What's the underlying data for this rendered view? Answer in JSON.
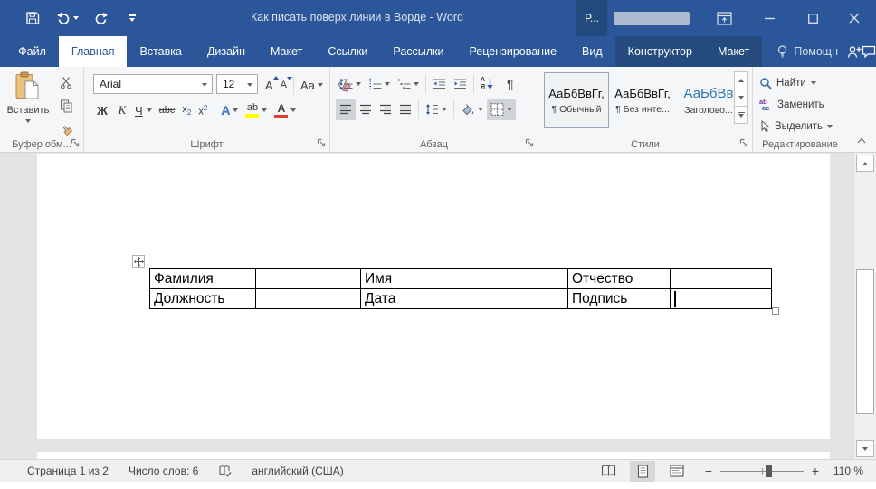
{
  "window": {
    "title": "Как писать поверх линии в Ворде - Word",
    "user": "Р..."
  },
  "tabs": [
    {
      "label": "Файл"
    },
    {
      "label": "Главная"
    },
    {
      "label": "Вставка"
    },
    {
      "label": "Дизайн"
    },
    {
      "label": "Макет"
    },
    {
      "label": "Ссылки"
    },
    {
      "label": "Рассылки"
    },
    {
      "label": "Рецензирование"
    },
    {
      "label": "Вид"
    },
    {
      "label": "Конструктор"
    },
    {
      "label": "Макет"
    }
  ],
  "help_label": "Помощн",
  "ribbon": {
    "clipboard": {
      "paste_label": "Вставить",
      "group_label": "Буфер обм..."
    },
    "font": {
      "font_name": "Arial",
      "font_size": "12",
      "bold": "Ж",
      "italic": "К",
      "underline": "Ч",
      "strikethrough": "abc",
      "sub_base": "x",
      "sub_mark": "2",
      "sup_base": "x",
      "sup_mark": "2",
      "grow": "А",
      "shrink": "А",
      "case_label": "Aa",
      "effects_label": "А",
      "highlight_label": "ab",
      "color_label": "А",
      "group_label": "Шрифт"
    },
    "paragraph": {
      "sort_a": "А",
      "sort_z": "Я",
      "pilcrow": "¶",
      "group_label": "Абзац"
    },
    "styles": {
      "group_label": "Стили",
      "items": [
        {
          "preview": "АаБбВвГг,",
          "name": "¶ Обычный"
        },
        {
          "preview": "АаБбВвГг,",
          "name": "¶ Без инте..."
        },
        {
          "preview": "АаБбВв",
          "name": "Заголово..."
        }
      ]
    },
    "editing": {
      "find": "Найти",
      "replace": "Заменить",
      "select": "Выделить",
      "group_label": "Редактирование"
    }
  },
  "icon_text": {
    "replace_top": "ab",
    "replace_bottom": "ac"
  },
  "document": {
    "table": {
      "rows": [
        [
          "Фамилия",
          "",
          "Имя",
          "",
          "Отчество",
          ""
        ],
        [
          "Должность",
          "",
          "Дата",
          "",
          "Подпись",
          ""
        ]
      ]
    }
  },
  "status_bar": {
    "page": "Страница 1 из 2",
    "words": "Число слов: 6",
    "language": "английский (США)",
    "zoom": "110 %"
  },
  "colors": {
    "titlebar": "#2b579a",
    "contextual_tab_bg": "#254a7d",
    "active_tab_text": "#2b579a",
    "highlight_yellow": "#ffff00",
    "font_color_red": "#e03c31"
  }
}
